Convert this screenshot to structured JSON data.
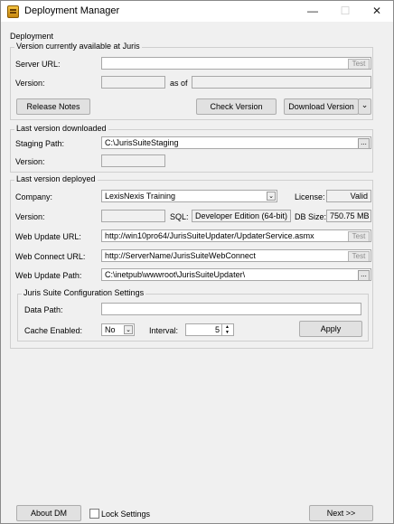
{
  "window": {
    "title": "Deployment Manager",
    "min_glyph": "—",
    "max_glyph": "☐",
    "close_glyph": "✕"
  },
  "client_label": "Deployment",
  "available": {
    "group_label": "Version currently available at Juris",
    "server_url_label": "Server URL:",
    "server_url_value": "",
    "test_label": "Test",
    "version_label": "Version:",
    "version_value": "",
    "as_of_label": "as of",
    "as_of_value": "",
    "release_notes_label": "Release Notes",
    "check_version_label": "Check Version",
    "download_version_label": "Download Version",
    "download_arrow": "⌄"
  },
  "downloaded": {
    "group_label": "Last version downloaded",
    "staging_path_label": "Staging Path:",
    "staging_path_value": "C:\\JurisSuiteStaging",
    "browse_label": "...",
    "version_label": "Version:",
    "version_value": ""
  },
  "deployed": {
    "group_label": "Last version deployed",
    "company_label": "Company:",
    "company_value": "LexisNexis Training",
    "license_label": "License:",
    "license_value": "Valid",
    "version_label": "Version:",
    "version_value": "",
    "sql_label": "SQL:",
    "sql_value": "Developer Edition (64-bit)",
    "db_size_label": "DB Size:",
    "db_size_value": "750.75 MB",
    "web_update_url_label": "Web Update URL:",
    "web_update_url_value": "http://win10pro64/JurisSuiteUpdater/UpdaterService.asmx",
    "web_connect_url_label": "Web Connect URL:",
    "web_connect_url_value": "http://ServerName/JurisSuiteWebConnect",
    "web_update_path_label": "Web Update Path:",
    "web_update_path_value": "C:\\inetpub\\wwwroot\\JurisSuiteUpdater\\",
    "test_label": "Test",
    "browse_label": "..."
  },
  "config": {
    "group_label": "Juris Suite Configuration Settings",
    "data_path_label": "Data Path:",
    "data_path_value": "",
    "cache_label": "Cache Enabled:",
    "cache_value": "No",
    "interval_label": "Interval:",
    "interval_value": "5",
    "apply_label": "Apply"
  },
  "footer": {
    "about_label": "About DM",
    "lock_label": "Lock Settings",
    "lock_checked": false,
    "next_label": "Next >>"
  }
}
